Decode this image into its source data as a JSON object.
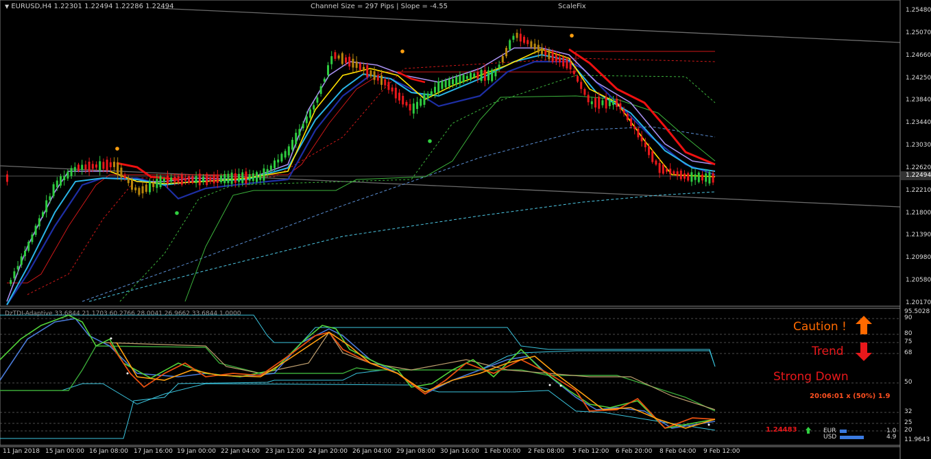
{
  "symbol_info": {
    "title": "EURUSD,H4",
    "ohlc": "1.22301 1.22494 1.22286 1.22494"
  },
  "channel_info": {
    "text": "Channel Size = 297 Pips  |  Slope = -4.55",
    "scalefix": "ScaleFix"
  },
  "price_axis": {
    "labels": [
      "1.25480",
      "1.25070",
      "1.24660",
      "1.24250",
      "1.23840",
      "1.23440",
      "1.23030",
      "1.22620",
      "1.22210",
      "1.21800",
      "1.21390",
      "1.20980",
      "1.20580",
      "1.20170"
    ],
    "current_price": "1.22494"
  },
  "indicator": {
    "title": "DzTDI-Adaptive 33.6844 21.1703 60.2766 28.0041 26.9662 33.6844 1.0000",
    "axis_labels": [
      "95.5028",
      "90",
      "80",
      "75",
      "68",
      "50",
      "32",
      "25",
      "20",
      "11.9643"
    ]
  },
  "signals": {
    "caution": "Caution !",
    "trend": "Trend",
    "status": "Strong Down",
    "timer": "20:06:01 x (50%) 1.9",
    "price_marker": "1.24483",
    "currency1": {
      "name": "EUR",
      "value": "1.0"
    },
    "currency2": {
      "name": "USD",
      "value": "4.9"
    }
  },
  "time_axis": {
    "labels": [
      "11 Jan 2018",
      "15 Jan 00:00",
      "16 Jan 08:00",
      "17 Jan 16:00",
      "19 Jan 00:00",
      "22 Jan 04:00",
      "23 Jan 12:00",
      "24 Jan 20:00",
      "26 Jan 04:00",
      "29 Jan 08:00",
      "30 Jan 16:00",
      "1 Feb 00:00",
      "2 Feb 08:00",
      "5 Feb 12:00",
      "6 Feb 20:00",
      "8 Feb 04:00",
      "9 Feb 12:00"
    ]
  },
  "colors": {
    "bull": "#2ecc40",
    "bear": "#e8181b",
    "neutral": "#b8860b",
    "axis": "#ffffff",
    "caution": "#ff6a00",
    "trend": "#e8181b"
  }
}
